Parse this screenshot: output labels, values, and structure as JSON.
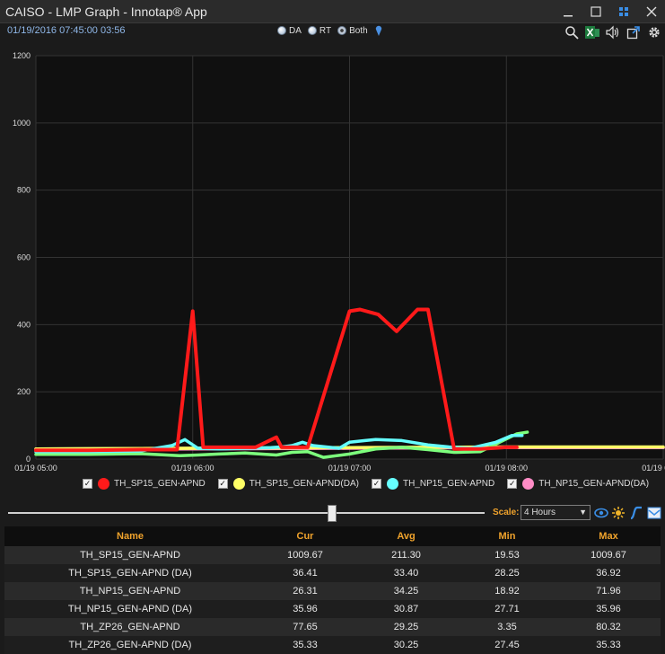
{
  "window": {
    "title": "CAISO - LMP Graph - Innotap® App"
  },
  "toolbar": {
    "datetime": "01/19/2016 07:45:00  03:56",
    "radios": [
      {
        "label": "DA",
        "checked": false
      },
      {
        "label": "RT",
        "checked": false
      },
      {
        "label": "Both",
        "checked": true
      }
    ],
    "icons": [
      "search-icon",
      "excel-export-icon",
      "sound-icon",
      "popout-icon",
      "settings-icon"
    ]
  },
  "chart_data": {
    "type": "line",
    "ylim": [
      0,
      1200
    ],
    "yticks": [
      0,
      200,
      400,
      600,
      800,
      1000,
      1200
    ],
    "xticks": [
      "01/19 05:00",
      "01/19 06:00",
      "01/19 07:00",
      "01/19 08:00",
      "01/19 09:00"
    ],
    "xlim": [
      0,
      240
    ],
    "series": [
      {
        "name": "TH_SP15_GEN-APND",
        "color": "#ff1a1a",
        "x": [
          0,
          20,
          40,
          52,
          54,
          60,
          64,
          70,
          72,
          80,
          84,
          92,
          94,
          100,
          104,
          120,
          124,
          131,
          138,
          146,
          150,
          160,
          164,
          170,
          180,
          184
        ],
        "y": [
          26,
          26,
          28,
          28,
          28,
          440,
          35,
          35,
          35,
          35,
          35,
          65,
          35,
          35,
          35,
          440,
          445,
          430,
          380,
          445,
          445,
          30,
          30,
          30,
          35,
          35
        ]
      },
      {
        "name": "TH_SP15_GEN-APND(DA)",
        "color": "#ffff66",
        "x": [
          0,
          60,
          120,
          180,
          240
        ],
        "y": [
          30,
          32,
          34,
          36,
          36
        ]
      },
      {
        "name": "TH_NP15_GEN-APND",
        "color": "#66ffff",
        "x": [
          0,
          20,
          40,
          52,
          57,
          62,
          70,
          80,
          90,
          94,
          98,
          102,
          106,
          116,
          120,
          126,
          130,
          140,
          150,
          158,
          166,
          176,
          182,
          186
        ],
        "y": [
          22,
          22,
          24,
          40,
          58,
          32,
          30,
          32,
          34,
          36,
          40,
          50,
          40,
          32,
          50,
          55,
          58,
          55,
          42,
          36,
          32,
          50,
          70,
          70
        ]
      },
      {
        "name": "TH_NP15_GEN-APND(DA)",
        "color": "#ff8cc6",
        "x": [
          0,
          60,
          120,
          180,
          240
        ],
        "y": [
          28,
          30,
          32,
          34,
          34
        ]
      },
      {
        "name": "TH_ZP26_GEN-APND",
        "color": "#7dff7d",
        "x": [
          0,
          20,
          40,
          55,
          62,
          70,
          80,
          92,
          98,
          104,
          110,
          120,
          130,
          140,
          150,
          160,
          170,
          180,
          184,
          188
        ],
        "y": [
          14,
          14,
          16,
          10,
          12,
          15,
          18,
          12,
          20,
          22,
          5,
          15,
          30,
          35,
          28,
          20,
          22,
          60,
          75,
          80
        ]
      },
      {
        "name": "TH_ZP26_GEN-APND (DA)",
        "color": "#f0c890",
        "x": [
          0,
          60,
          120,
          180,
          240
        ],
        "y": [
          30,
          32,
          34,
          35,
          34
        ]
      }
    ],
    "legend": [
      {
        "label": "TH_SP15_GEN-APND",
        "color": "#ff1a1a"
      },
      {
        "label": "TH_SP15_GEN-APND(DA)",
        "color": "#ffff66"
      },
      {
        "label": "TH_NP15_GEN-APND",
        "color": "#66ffff"
      },
      {
        "label": "TH_NP15_GEN-APND(DA)",
        "color": "#ff8cc6"
      }
    ]
  },
  "slider": {
    "scale_label": "Scale:",
    "scale_value": "4 Hours",
    "position": 0.68
  },
  "table": {
    "headers": [
      "Name",
      "Cur",
      "Avg",
      "Min",
      "Max"
    ],
    "rows": [
      [
        "TH_SP15_GEN-APND",
        "1009.67",
        "211.30",
        "19.53",
        "1009.67"
      ],
      [
        "TH_SP15_GEN-APND (DA)",
        "36.41",
        "33.40",
        "28.25",
        "36.92"
      ],
      [
        "TH_NP15_GEN-APND",
        "26.31",
        "34.25",
        "18.92",
        "71.96"
      ],
      [
        "TH_NP15_GEN-APND (DA)",
        "35.96",
        "30.87",
        "27.71",
        "35.96"
      ],
      [
        "TH_ZP26_GEN-APND",
        "77.65",
        "29.25",
        "3.35",
        "80.32"
      ],
      [
        "TH_ZP26_GEN-APND (DA)",
        "35.33",
        "30.25",
        "27.45",
        "35.33"
      ]
    ]
  }
}
